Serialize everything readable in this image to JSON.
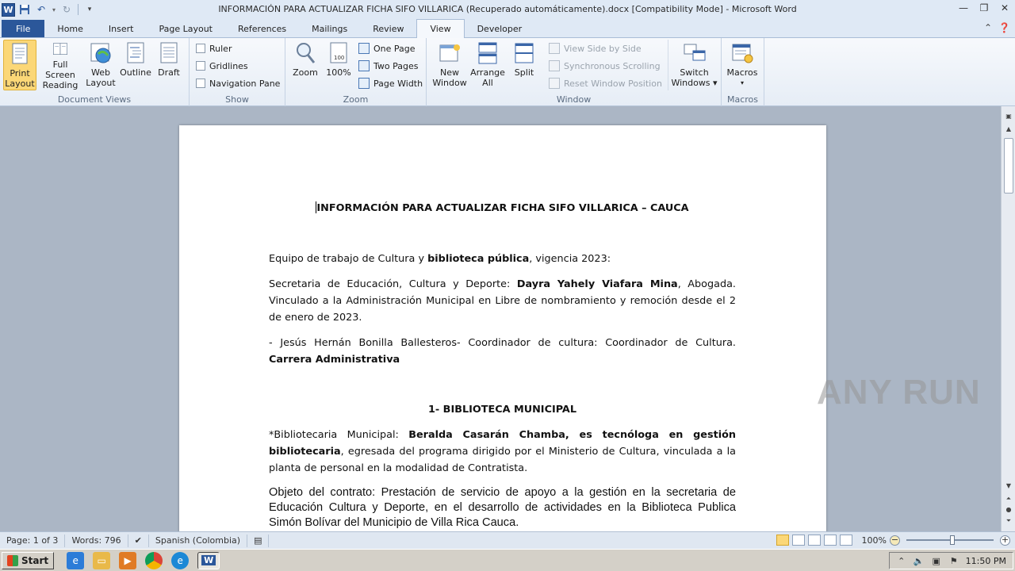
{
  "window": {
    "title": "INFORMACIÓN PARA ACTUALIZAR FICHA SIFO VILLARICA (Recuperado automáticamente).docx [Compatibility Mode]  -  Microsoft Word",
    "app_icon_letter": "W"
  },
  "tabs": [
    {
      "label": "File"
    },
    {
      "label": "Home"
    },
    {
      "label": "Insert"
    },
    {
      "label": "Page Layout"
    },
    {
      "label": "References"
    },
    {
      "label": "Mailings"
    },
    {
      "label": "Review"
    },
    {
      "label": "View"
    },
    {
      "label": "Developer"
    }
  ],
  "ribbon": {
    "document_views": {
      "label": "Document Views",
      "print_layout": [
        "Print",
        "Layout"
      ],
      "full_screen": [
        "Full Screen",
        "Reading"
      ],
      "web_layout": [
        "Web",
        "Layout"
      ],
      "outline": "Outline",
      "draft": "Draft"
    },
    "show": {
      "label": "Show",
      "ruler": "Ruler",
      "gridlines": "Gridlines",
      "nav_pane": "Navigation Pane"
    },
    "zoom": {
      "label": "Zoom",
      "zoom_btn": "Zoom",
      "hundred": "100%",
      "one_page": "One Page",
      "two_pages": "Two Pages",
      "page_width": "Page Width"
    },
    "window": {
      "label": "Window",
      "new_window": [
        "New",
        "Window"
      ],
      "arrange_all": [
        "Arrange",
        "All"
      ],
      "split": "Split",
      "view_side": "View Side by Side",
      "sync_scroll": "Synchronous Scrolling",
      "reset_pos": "Reset Window Position",
      "switch_windows": [
        "Switch",
        "Windows ▾"
      ]
    },
    "macros": {
      "label": "Macros",
      "macros_btn": "Macros"
    }
  },
  "document": {
    "title": "INFORMACIÓN PARA ACTUALIZAR FICHA SIFO VILLARICA – CAUCA",
    "p1_a": "Equipo de trabajo de Cultura y ",
    "p1_b": "biblioteca pública",
    "p1_c": ", vigencia 2023:",
    "p2_a": "Secretaria de Educación, Cultura y Deporte: ",
    "p2_b": "Dayra Yahely Viafara Mina",
    "p2_c": ", Abogada. Vinculado a la Administración Municipal en Libre de nombramiento y remoción desde el 2 de enero de 2023.",
    "p3_a": "- Jesús Hernán Bonilla Ballesteros- Coordinador de cultura: Coordinador de Cultura. ",
    "p3_b": "Carrera Administrativa",
    "section1": "1- BIBLIOTECA MUNICIPAL",
    "p4_a": "*Bibliotecaria Municipal: ",
    "p4_b": "Beralda Casarán Chamba, es tecnóloga en gestión bibliotecaria",
    "p4_c": ", egresada del programa dirigido por el Ministerio de Cultura, vinculada a la planta de personal en la modalidad de Contratista.",
    "p5": "Objeto del contrato: Prestación de servicio de apoyo a la gestión en la secretaria de Educación Cultura y Deporte, en el desarrollo de actividades en la Biblioteca Publica Simón Bolívar del Municipio de Villa Rica Cauca."
  },
  "watermark": "ANY RUN",
  "statusbar": {
    "page": "Page: 1 of 3",
    "words": "Words: 796",
    "language": "Spanish (Colombia)",
    "zoom": "100%"
  },
  "taskbar": {
    "start": "Start",
    "time": "11:50 PM"
  }
}
